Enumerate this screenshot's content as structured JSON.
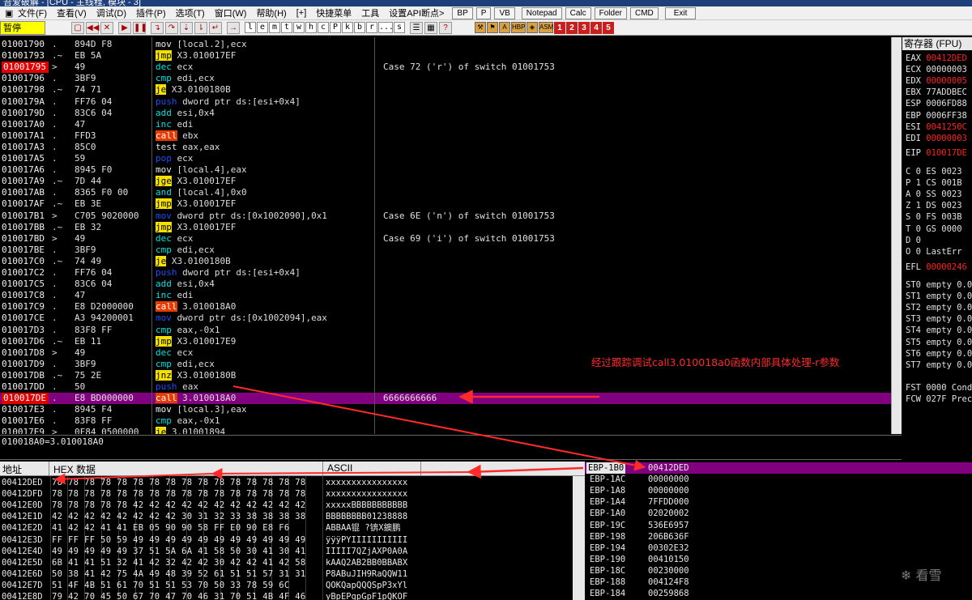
{
  "window": {
    "title": "吾爱破解 - [CPU - 主线程, 模块 - 3]"
  },
  "menu": [
    "文件(F)",
    "查看(V)",
    "调试(D)",
    "插件(P)",
    "选项(T)",
    "窗口(W)",
    "帮助(H)",
    "[+]",
    "快捷菜单",
    "工具",
    "设置API断点>"
  ],
  "menu_buttons": [
    "BP",
    "P",
    "VB",
    "Notepad",
    "Calc",
    "Folder",
    "CMD",
    "Exit"
  ],
  "status": "暂停",
  "toolbar_letters": [
    "l",
    "e",
    "m",
    "t",
    "w",
    "h",
    "c",
    "P",
    "k",
    "b",
    "r",
    "...",
    "s"
  ],
  "toolbar_numbers": [
    "1",
    "2",
    "3",
    "4",
    "5"
  ],
  "disasm": [
    {
      "addr": "01001790",
      "jm": ".",
      "hex": "894D F8",
      "mn": "mov",
      "op": "[local.2],ecx",
      "cls": "mov",
      "cm": ""
    },
    {
      "addr": "01001793",
      "jm": ".~",
      "hex": "EB 5A",
      "mn": "jmp",
      "op": "X3.010017EF",
      "cls": "jmp",
      "cm": ""
    },
    {
      "addr": "01001795",
      "jm": ">",
      "hex": "49",
      "mn": "dec",
      "op": "ecx",
      "cls": "math",
      "cm": "Case 72 ('r') of switch 01001753",
      "red": true
    },
    {
      "addr": "01001796",
      "jm": ".",
      "hex": "3BF9",
      "mn": "cmp",
      "op": "edi,ecx",
      "cls": "math",
      "cm": ""
    },
    {
      "addr": "01001798",
      "jm": ".~",
      "hex": "74 71",
      "mn": "je",
      "op": "X3.0100180B",
      "cls": "jmp",
      "cm": ""
    },
    {
      "addr": "0100179A",
      "jm": ".",
      "hex": "FF76 04",
      "mn": "push",
      "op": "dword ptr ds:[esi+0x4]",
      "cls": "push",
      "cm": ""
    },
    {
      "addr": "0100179D",
      "jm": ".",
      "hex": "83C6 04",
      "mn": "add",
      "op": "esi,0x4",
      "cls": "math",
      "cm": ""
    },
    {
      "addr": "010017A0",
      "jm": ".",
      "hex": "47",
      "mn": "inc",
      "op": "edi",
      "cls": "math",
      "cm": ""
    },
    {
      "addr": "010017A1",
      "jm": ".",
      "hex": "FFD3",
      "mn": "call",
      "op": "ebx",
      "cls": "call",
      "cm": ""
    },
    {
      "addr": "010017A3",
      "jm": ".",
      "hex": "85C0",
      "mn": "test",
      "op": "eax,eax",
      "cls": "def",
      "cm": ""
    },
    {
      "addr": "010017A5",
      "jm": ".",
      "hex": "59",
      "mn": "pop",
      "op": "ecx",
      "cls": "push",
      "cm": ""
    },
    {
      "addr": "010017A6",
      "jm": ".",
      "hex": "8945 F0",
      "mn": "mov",
      "op": "[local.4],eax",
      "cls": "mov",
      "cm": ""
    },
    {
      "addr": "010017A9",
      "jm": ".~",
      "hex": "7D 44",
      "mn": "jge",
      "op": "X3.010017EF",
      "cls": "jmp",
      "cm": ""
    },
    {
      "addr": "010017AB",
      "jm": ".",
      "hex": "8365 F0 00",
      "mn": "and",
      "op": "[local.4],0x0",
      "cls": "math",
      "cm": ""
    },
    {
      "addr": "010017AF",
      "jm": ".~",
      "hex": "EB 3E",
      "mn": "jmp",
      "op": "X3.010017EF",
      "cls": "jmp",
      "cm": ""
    },
    {
      "addr": "010017B1",
      "jm": ">",
      "hex": "C705 9020000",
      "mn": "mov",
      "op": "dword ptr ds:[0x1002090],0x1",
      "cls": "push",
      "cm": "Case 6E ('n') of switch 01001753"
    },
    {
      "addr": "010017BB",
      "jm": ".~",
      "hex": "EB 32",
      "mn": "jmp",
      "op": "X3.010017EF",
      "cls": "jmp",
      "cm": ""
    },
    {
      "addr": "010017BD",
      "jm": ">",
      "hex": "49",
      "mn": "dec",
      "op": "ecx",
      "cls": "math",
      "cm": "Case 69 ('i') of switch 01001753"
    },
    {
      "addr": "010017BE",
      "jm": ".",
      "hex": "3BF9",
      "mn": "cmp",
      "op": "edi,ecx",
      "cls": "math",
      "cm": ""
    },
    {
      "addr": "010017C0",
      "jm": ".~",
      "hex": "74 49",
      "mn": "je",
      "op": "X3.0100180B",
      "cls": "jmp",
      "cm": ""
    },
    {
      "addr": "010017C2",
      "jm": ".",
      "hex": "FF76 04",
      "mn": "push",
      "op": "dword ptr ds:[esi+0x4]",
      "cls": "push",
      "cm": ""
    },
    {
      "addr": "010017C5",
      "jm": ".",
      "hex": "83C6 04",
      "mn": "add",
      "op": "esi,0x4",
      "cls": "math",
      "cm": ""
    },
    {
      "addr": "010017C8",
      "jm": ".",
      "hex": "47",
      "mn": "inc",
      "op": "edi",
      "cls": "math",
      "cm": ""
    },
    {
      "addr": "010017C9",
      "jm": ".",
      "hex": "E8 D2000000",
      "mn": "call",
      "op": "3.010018A0",
      "cls": "call",
      "cm": ""
    },
    {
      "addr": "010017CE",
      "jm": ".",
      "hex": "A3 94200001",
      "mn": "mov",
      "op": "dword ptr ds:[0x1002094],eax",
      "cls": "push",
      "cm": ""
    },
    {
      "addr": "010017D3",
      "jm": ".",
      "hex": "83F8 FF",
      "mn": "cmp",
      "op": "eax,-0x1",
      "cls": "math",
      "cm": ""
    },
    {
      "addr": "010017D6",
      "jm": ".~",
      "hex": "EB 11",
      "mn": "jmp",
      "op": "X3.010017E9",
      "cls": "jmp",
      "cm": ""
    },
    {
      "addr": "010017D8",
      "jm": ">",
      "hex": "49",
      "mn": "dec",
      "op": "ecx",
      "cls": "math",
      "cm": ""
    },
    {
      "addr": "010017D9",
      "jm": ".",
      "hex": "3BF9",
      "mn": "cmp",
      "op": "edi,ecx",
      "cls": "math",
      "cm": ""
    },
    {
      "addr": "010017DB",
      "jm": ".~",
      "hex": "75 2E",
      "mn": "jnz",
      "op": "X3.0100180B",
      "cls": "jmp",
      "cm": ""
    },
    {
      "addr": "010017DD",
      "jm": ".",
      "hex": "50",
      "mn": "push",
      "op": "eax",
      "cls": "push",
      "cm": ""
    },
    {
      "addr": "010017DE",
      "jm": ".",
      "hex": "E8 BD000000",
      "mn": "call",
      "op": "3.010018A0",
      "cls": "call",
      "cm": "6666666666",
      "sel": true,
      "red": true
    },
    {
      "addr": "010017E3",
      "jm": ".",
      "hex": "8945 F4",
      "mn": "mov",
      "op": "[local.3],eax",
      "cls": "mov",
      "cm": ""
    },
    {
      "addr": "010017E6",
      "jm": ".",
      "hex": "83F8 FF",
      "mn": "cmp",
      "op": "eax,-0x1",
      "cls": "math",
      "cm": ""
    },
    {
      "addr": "010017E9",
      "jm": ">",
      "hex": "0F84 0500000",
      "mn": "je",
      "op": "3.01001894",
      "cls": "jmp",
      "cm": ""
    }
  ],
  "info": "010018A0=3.010018A0",
  "registers": {
    "title": "寄存器 (FPU)",
    "gp": [
      {
        "n": "EAX",
        "v": "00412DED",
        "red": true
      },
      {
        "n": "ECX",
        "v": "00000003",
        "red": false
      },
      {
        "n": "EDX",
        "v": "00000005",
        "red": true
      },
      {
        "n": "EBX",
        "v": "77ADDBEC",
        "red": false
      },
      {
        "n": "ESP",
        "v": "0006FD88",
        "red": false
      },
      {
        "n": "EBP",
        "v": "0006FF38",
        "red": false
      },
      {
        "n": "ESI",
        "v": "0041250C",
        "red": true
      },
      {
        "n": "EDI",
        "v": "00000003",
        "red": true
      }
    ],
    "eip": {
      "n": "EIP",
      "v": "010017DE"
    },
    "flags": [
      {
        "t": "C 0  ES 0023"
      },
      {
        "t": "P 1  CS 001B"
      },
      {
        "t": "A 0  SS 0023"
      },
      {
        "t": "Z 1  DS 0023"
      },
      {
        "t": "S 0  FS 003B"
      },
      {
        "t": "T 0  GS 0000"
      },
      {
        "t": "D 0"
      },
      {
        "t": "O 0  LastErr"
      }
    ],
    "efl": {
      "n": "EFL",
      "v": "00000246"
    },
    "fpu": [
      "ST0 empty 0.0",
      "ST1 empty 0.0",
      "ST2 empty 0.0",
      "ST3 empty 0.0",
      "ST4 empty 0.0",
      "ST5 empty 0.0",
      "ST6 empty 0.0",
      "ST7 empty 0.0"
    ],
    "fst": "FST 0000  Cond",
    "fcw": "FCW 027F  Prec"
  },
  "dump": {
    "headers": {
      "addr": "地址",
      "hex": "HEX 数据",
      "ascii": "ASCII"
    },
    "rows": [
      {
        "a": "00412DED",
        "h": "78 78 78 78 78 78 78 78 78 78 78 78 78 78 78 78",
        "s": "xxxxxxxxxxxxxxxx"
      },
      {
        "a": "00412DFD",
        "h": "78 78 78 78 78 78 78 78 78 78 78 78 78 78 78 78",
        "s": "xxxxxxxxxxxxxxxx"
      },
      {
        "a": "00412E0D",
        "h": "78 78 78 78 78 42 42 42 42 42 42 42 42 42 42 42",
        "s": "xxxxxBBBBBBBBBBB"
      },
      {
        "a": "00412E1D",
        "h": "42 42 42 42 42 42 42 42 30 31 32 33 38 38 38 38",
        "s": "BBBBBBBB01238888"
      },
      {
        "a": "00412E2D",
        "h": "41 42 42 41 41 EB 05 90 90 58 FF E0 90 E8 F6",
        "s": "ABBAA锟 ?锛X鐭鹏"
      },
      {
        "a": "00412E3D",
        "h": "FF FF FF 50 59 49 49 49 49 49 49 49 49 49 49 49",
        "s": "ÿÿÿPYIIIIIIIIIII"
      },
      {
        "a": "00412E4D",
        "h": "49 49 49 49 49 37 51 5A 6A 41 58 50 30 41 30 41",
        "s": "IIIII7QZjAXP0A0A"
      },
      {
        "a": "00412E5D",
        "h": "6B 41 41 51 32 41 42 32 42 42 30 42 42 41 42 58",
        "s": "kAAQ2AB2BB0BBABX"
      },
      {
        "a": "00412E6D",
        "h": "50 38 41 42 75 4A 49 48 39 52 61 51 51 57 31 31",
        "s": "P8ABuJIH9RaQQW11"
      },
      {
        "a": "00412E7D",
        "h": "51 4F 4B 51 61 70 51 51 53 70 50 33 78 59 6C",
        "s": "QOKQapQQQSpP3xYl"
      },
      {
        "a": "00412E8D",
        "h": "79 42 70 45 50 67 70 47 70 46 31 70 51 4B 4F 46",
        "s": "yBpEPgpGpF1pQKOF"
      }
    ]
  },
  "stack": [
    {
      "l": "EBP-1B0",
      "v": "00412DED",
      "sel": true
    },
    {
      "l": "EBP-1AC",
      "v": "00000000"
    },
    {
      "l": "EBP-1A8",
      "v": "00000000"
    },
    {
      "l": "EBP-1A4",
      "v": "7FFDD000"
    },
    {
      "l": "EBP-1A0",
      "v": "02020002"
    },
    {
      "l": "EBP-19C",
      "v": "536E6957"
    },
    {
      "l": "EBP-198",
      "v": "206B636F"
    },
    {
      "l": "EBP-194",
      "v": "00302E32"
    },
    {
      "l": "EBP-190",
      "v": "00410150"
    },
    {
      "l": "EBP-18C",
      "v": "00230000"
    },
    {
      "l": "EBP-188",
      "v": "004124F8"
    },
    {
      "l": "EBP-184",
      "v": "00259868"
    }
  ],
  "annotation": "经过跟踪调试call3.010018a0函数内部具体处理-r参数",
  "watermark": "看雪",
  "colors": {
    "selection": "#800080",
    "arrow": "#ff2a2a",
    "jump": "#f5e100",
    "call": "#e53a00",
    "push": "#1d4dff",
    "math": "#00e3e3"
  }
}
